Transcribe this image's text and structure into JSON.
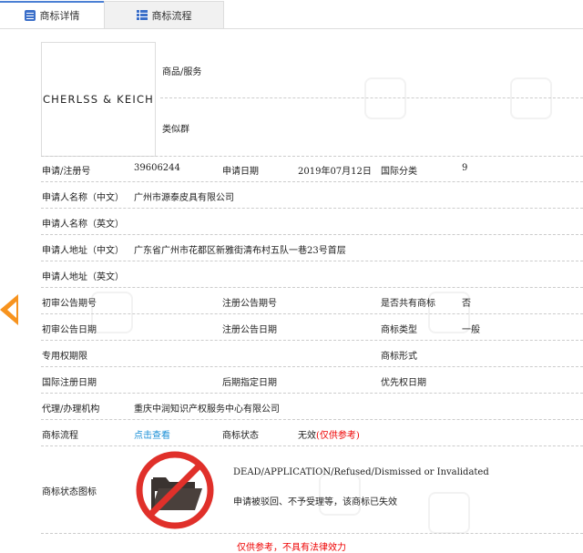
{
  "tabs": [
    {
      "label": "商标详情",
      "icon": "document-list-icon",
      "active": true
    },
    {
      "label": "商标流程",
      "icon": "list-icon",
      "active": false
    }
  ],
  "logo_text": "CHERLSS & KEICH",
  "goods_label": "商品/服务",
  "similar_label": "类似群",
  "rows": {
    "reg_no_label": "申请/注册号",
    "reg_no": "39606244",
    "app_date_label": "申请日期",
    "app_date": "2019年07月12日",
    "intl_class_label": "国际分类",
    "intl_class": "9",
    "name_cn_label": "申请人名称（中文）",
    "name_cn": "广州市源泰皮具有限公司",
    "name_en_label": "申请人名称（英文）",
    "addr_cn_label": "申请人地址（中文）",
    "addr_cn": "广东省广州市花都区新雅街清布村五队一巷23号首层",
    "addr_en_label": "申请人地址（英文）",
    "prelim_no_label": "初审公告期号",
    "reg_pub_no_label": "注册公告期号",
    "shared_label": "是否共有商标",
    "shared": "否",
    "prelim_date_label": "初审公告日期",
    "reg_pub_date_label": "注册公告日期",
    "type_label": "商标类型",
    "type": "一般",
    "term_label": "专用权期限",
    "form_label": "商标形式",
    "intl_reg_date_label": "国际注册日期",
    "later_date_label": "后期指定日期",
    "priority_date_label": "优先权日期",
    "agent_label": "代理/办理机构",
    "agent": "重庆中润知识产权服务中心有限公司",
    "flow_label": "商标流程",
    "flow_link": "点击查看",
    "status_label": "商标状态",
    "status": "无效",
    "status_note": "(仅供参考)",
    "status_icon_label": "商标状态图标",
    "status_en": "DEAD/APPLICATION/Refused/Dismissed or Invalidated",
    "status_cn": "申请被驳回、不予受理等，该商标已失效"
  },
  "footer": "仅供参考，不具有法律效力",
  "colors": {
    "accent": "#3b6fc9",
    "link": "#1a8fd6",
    "warning": "#e00000",
    "arrow": "#f7931e"
  }
}
